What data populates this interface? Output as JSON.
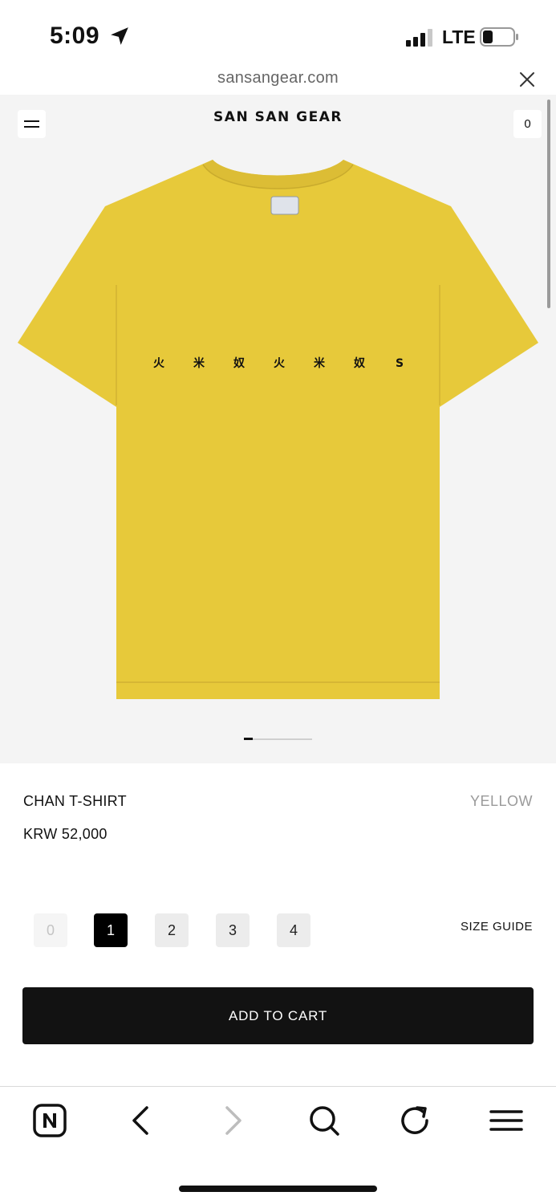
{
  "status_bar": {
    "time": "5:09",
    "network": "LTE",
    "location_icon": "location-arrow-icon",
    "signal_icon": "cellular-signal-icon",
    "battery_icon": "battery-low-icon"
  },
  "browser": {
    "url": "sansangear.com",
    "close_icon": "close-icon"
  },
  "header": {
    "brand": "SAN SAN GEAR",
    "cart_count": "0",
    "menu_icon": "hamburger-menu-icon"
  },
  "product": {
    "name": "CHAN T-SHIRT",
    "color": "YELLOW",
    "price": "KRW 52,000",
    "shirt_color": "#e7c93a",
    "print_glyphs": [
      "火",
      "米",
      "奴",
      "火",
      "米",
      "奴",
      "S"
    ],
    "image_index": 1,
    "image_count": 8
  },
  "sizes": {
    "options": [
      "0",
      "1",
      "2",
      "3",
      "4"
    ],
    "selected": "1",
    "disabled": [
      "0"
    ],
    "guide_label": "SIZE GUIDE"
  },
  "cta": {
    "add_to_cart": "ADD TO CART"
  },
  "toolbar": {
    "icons": [
      "naver-n-icon",
      "back-arrow-icon",
      "forward-arrow-icon",
      "search-icon",
      "refresh-icon",
      "menu-icon"
    ]
  },
  "colors": {
    "accent": "#121212",
    "hero_bg": "#f4f4f4",
    "muted": "#9a9a9a"
  }
}
